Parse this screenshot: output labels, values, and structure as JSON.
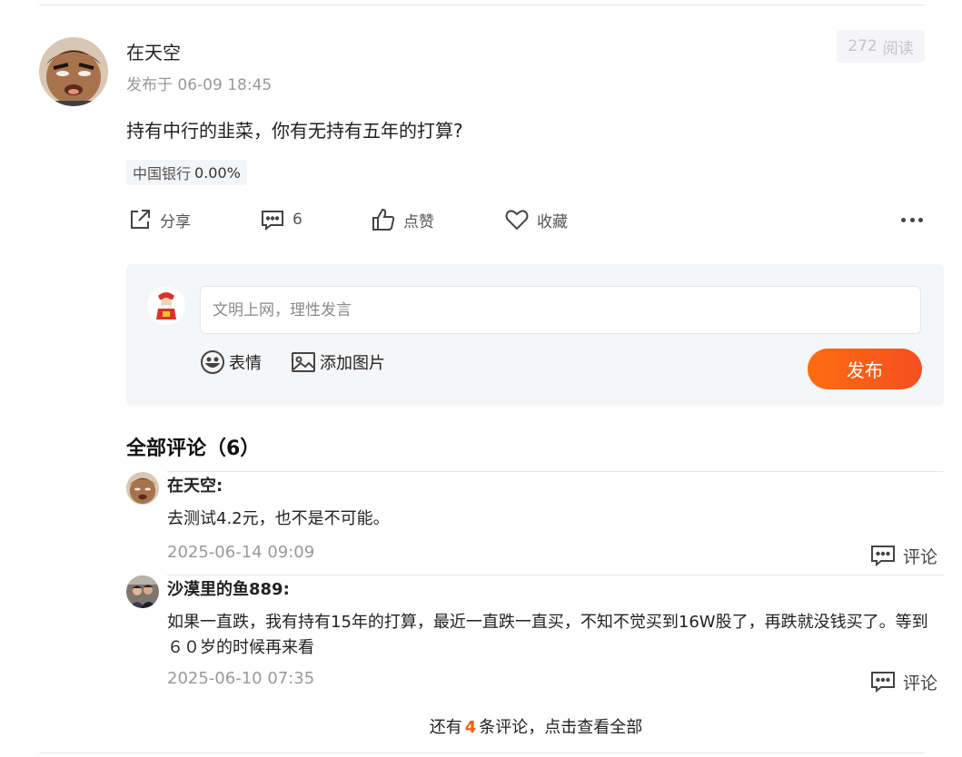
{
  "post": {
    "author": "在天空",
    "time": "发布于 06-09 18:45",
    "read_count": "272",
    "read_label": "阅读",
    "content": "持有中行的韭菜，你有无持有五年的打算?",
    "stock": {
      "name": "中国银行",
      "change": "0.00%"
    }
  },
  "actions": {
    "share": "分享",
    "comment_count": "6",
    "like": "点赞",
    "favorite": "收藏"
  },
  "composer": {
    "placeholder": "文明上网，理性发言",
    "emoji": "表情",
    "add_image": "添加图片",
    "publish": "发布"
  },
  "comments_section": {
    "title": "全部评论（6）",
    "items": [
      {
        "user": "在天空:",
        "text": "去测试4.2元，也不是不可能。",
        "date": "2025-06-14 09:09",
        "reply": "评论"
      },
      {
        "user": "沙漠里的鱼889:",
        "text": "如果一直跌，我有持有15年的打算，最近一直跌一直买，不知不觉买到16W股了，再跌就没钱买了。等到６０岁的时候再来看",
        "date": "2025-06-10 07:35",
        "reply": "评论"
      }
    ],
    "more_prefix": "还有",
    "more_count": "4",
    "more_suffix": "条评论，点击查看全部"
  },
  "colors": {
    "accent": "#f45020",
    "muted": "#999999"
  },
  "icons": [
    "share-icon",
    "comment-icon",
    "like-icon",
    "heart-icon",
    "more-icon",
    "emoji-icon",
    "image-icon",
    "reply-icon"
  ]
}
